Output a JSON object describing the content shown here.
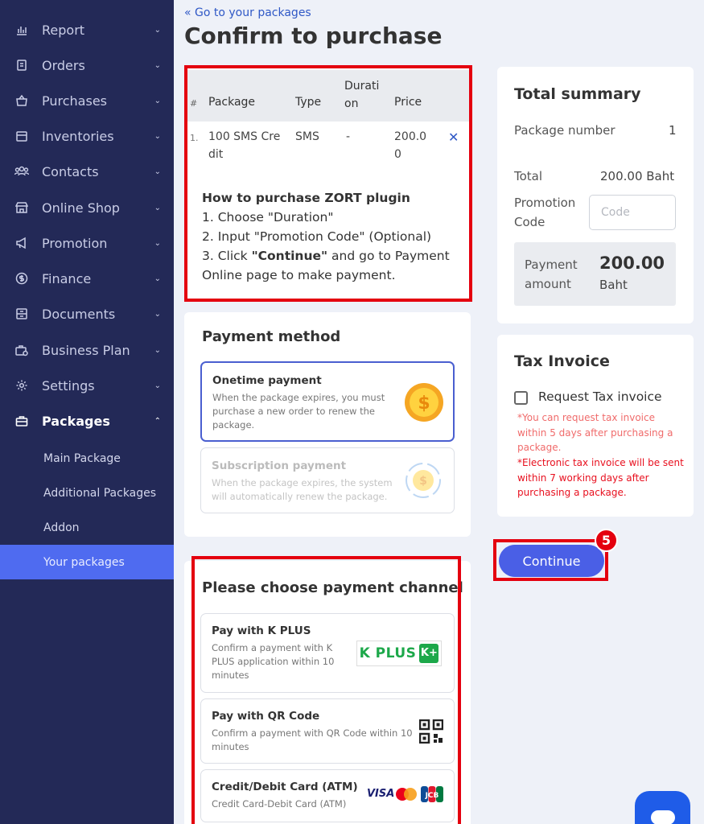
{
  "sidebar": {
    "items": [
      {
        "label": "Report",
        "icon": "report-icon"
      },
      {
        "label": "Orders",
        "icon": "orders-icon"
      },
      {
        "label": "Purchases",
        "icon": "purchases-icon"
      },
      {
        "label": "Inventories",
        "icon": "inventories-icon"
      },
      {
        "label": "Contacts",
        "icon": "contacts-icon"
      },
      {
        "label": "Online Shop",
        "icon": "online-shop-icon"
      },
      {
        "label": "Promotion",
        "icon": "promotion-icon"
      },
      {
        "label": "Finance",
        "icon": "finance-icon"
      },
      {
        "label": "Documents",
        "icon": "documents-icon"
      },
      {
        "label": "Business Plan",
        "icon": "business-plan-icon"
      },
      {
        "label": "Settings",
        "icon": "settings-icon"
      },
      {
        "label": "Packages",
        "icon": "packages-icon"
      }
    ],
    "subitems": [
      {
        "label": "Main Package"
      },
      {
        "label": "Additional Packages"
      },
      {
        "label": "Addon"
      },
      {
        "label": "Your packages"
      }
    ],
    "accent_color": "#4f6bf0",
    "bg_color": "#232957"
  },
  "header": {
    "back_link": "Go to your packages",
    "title": "Confirm to purchase"
  },
  "package_table": {
    "columns": [
      "#",
      "Package",
      "Type",
      "Durati on",
      "Price"
    ],
    "rows": [
      {
        "index": "1.",
        "package": "100 SMS Cre dit",
        "type": "SMS",
        "duration": "-",
        "price": "200.0 0"
      }
    ]
  },
  "howto": {
    "title": "How to purchase ZORT plugin",
    "step1": "1. Choose \"Duration\"",
    "step2": "2. Input \"Promotion Code\" (Optional)",
    "step3_prefix": "3. Click ",
    "step3_bold": "\"Continue\"",
    "step3_suffix": " and go to Payment Online page to make payment."
  },
  "payment_method": {
    "title": "Payment method",
    "onetime_title": "Onetime payment",
    "onetime_desc": "When the package expires, you must purchase a new order to renew the package.",
    "subscription_title": "Subscription payment",
    "subscription_desc": "When the package expires, the system will automatically renew the package."
  },
  "payment_channel": {
    "title": "Please choose payment channel",
    "kplus_title": "Pay with K PLUS",
    "kplus_desc": "Confirm a payment with K PLUS application within 10 minutes",
    "kplus_logo": "K PLUS",
    "qr_title": "Pay with QR Code",
    "qr_desc": "Confirm a payment with QR Code within 10 minutes",
    "card_title": "Credit/Debit Card (ATM)",
    "card_desc": "Credit Card-Debit Card (ATM)",
    "visa_label": "VISA"
  },
  "summary": {
    "title": "Total summary",
    "package_number_label": "Package number",
    "package_number_value": "1",
    "total_label": "Total",
    "total_value": "200.00 Baht",
    "promo_label": "Promotion Code",
    "promo_placeholder": "Code",
    "payment_amount_label": "Payment amount",
    "payment_amount_value": "200.00",
    "payment_amount_unit": "Baht"
  },
  "tax": {
    "title": "Tax Invoice",
    "checkbox_label": "Request Tax invoice",
    "note1": "*You can request tax invoice within 5 days after purchasing a package.",
    "note2": "*Electronic tax invoice will be sent within 7 working days after purchasing a package."
  },
  "actions": {
    "continue_label": "Continue",
    "step_badge": "5"
  },
  "colors": {
    "highlight_red": "#e4000f",
    "primary_blue": "#4a5fe6",
    "note_light_red": "#f06b6b",
    "note_red": "#e8101f"
  }
}
